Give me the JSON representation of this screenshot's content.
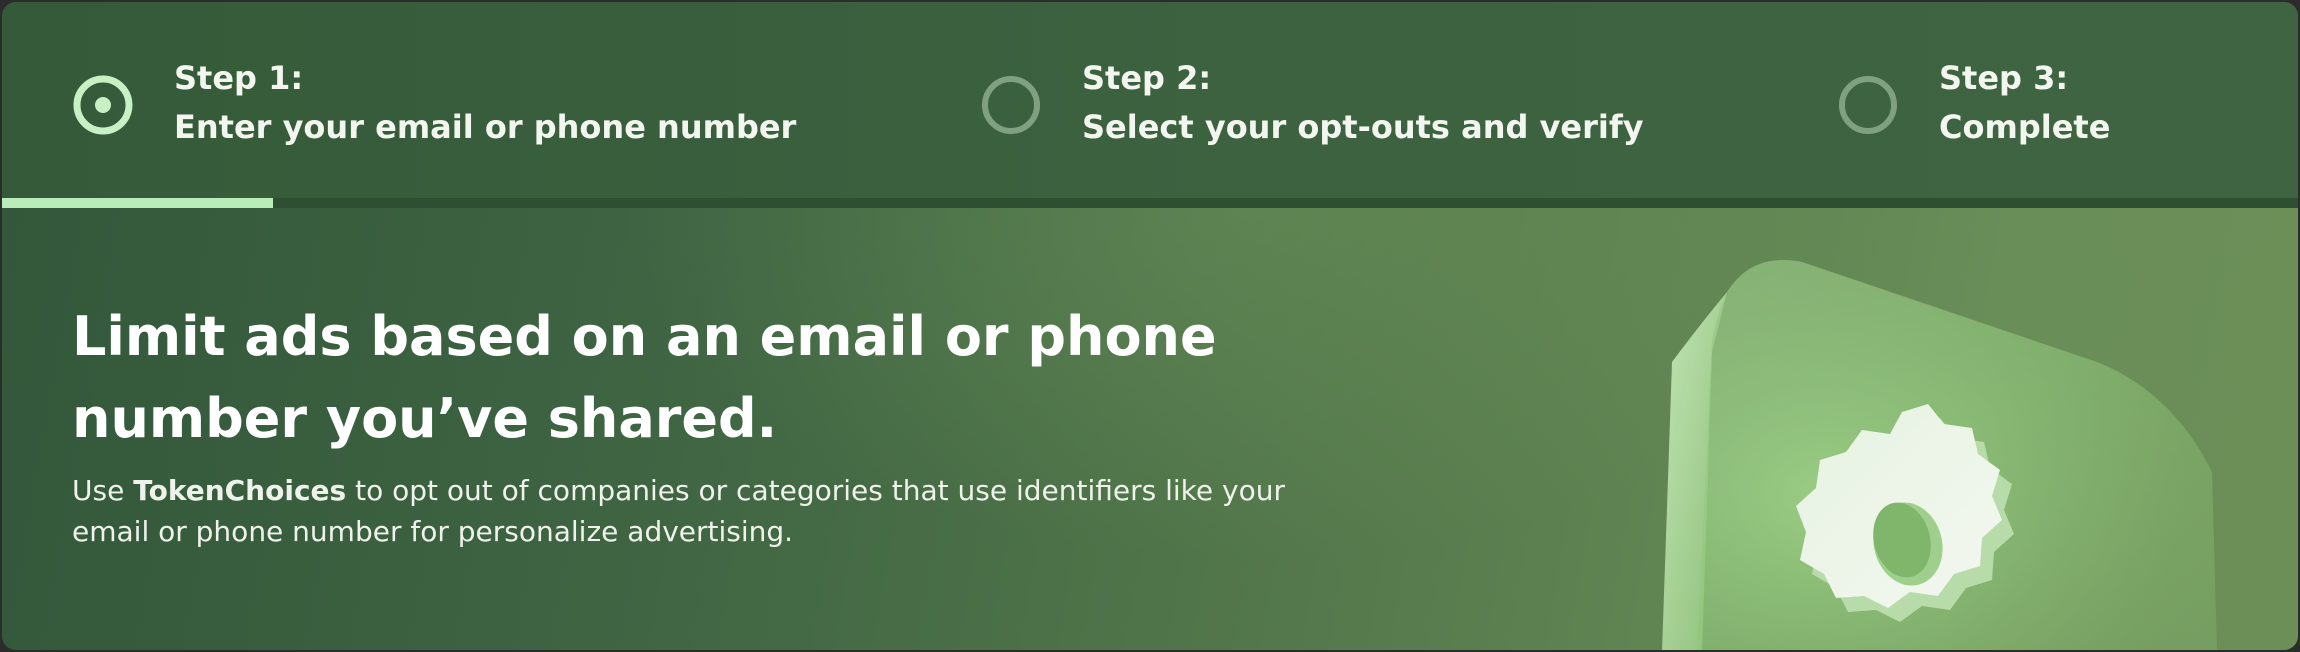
{
  "stepper": {
    "steps": [
      {
        "number": "Step 1:",
        "description": "Enter your email or phone number",
        "state": "current"
      },
      {
        "number": "Step 2:",
        "description": "Select your opt-outs and verify",
        "state": "upcoming"
      },
      {
        "number": "Step 3:",
        "description": "Complete",
        "state": "upcoming"
      }
    ],
    "progress_fraction": 0.118
  },
  "hero": {
    "title": "Limit ads based on an email or phone number you’ve shared.",
    "body_prefix": "Use ",
    "brand": "TokenChoices",
    "body_suffix": " to opt out of companies or categories that use identifiers like your email or phone number for personalize advertising.",
    "illustration_icon": "gear-icon"
  },
  "colors": {
    "accent": "#b9ecb8",
    "header_bg": "#3a5f3e",
    "inactive_marker": "#7fa17f"
  }
}
